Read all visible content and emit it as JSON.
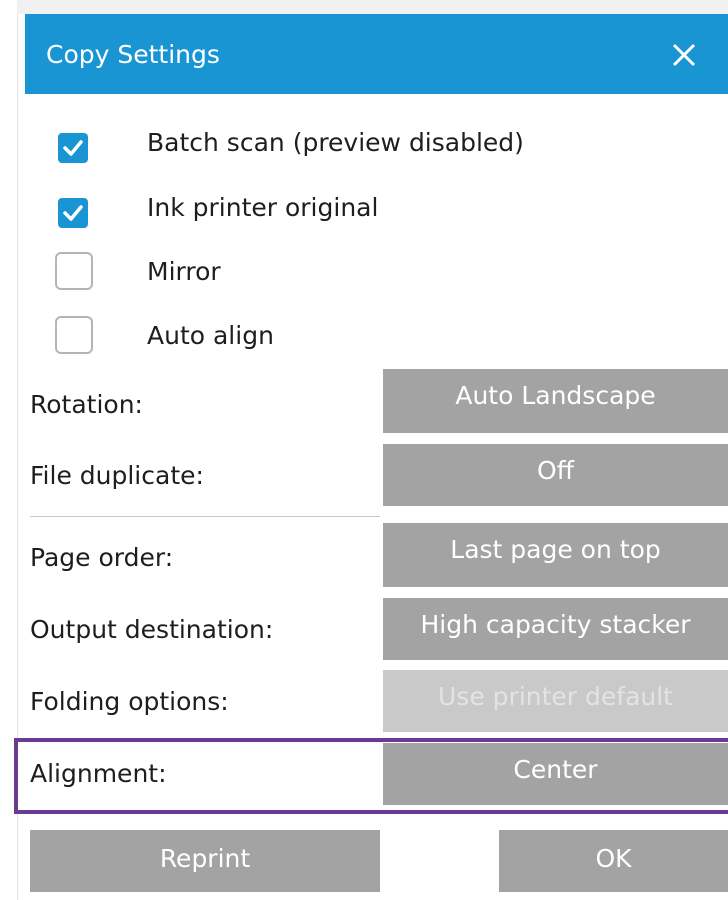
{
  "dialog": {
    "title": "Copy Settings",
    "close_icon": "close-icon",
    "accent_color": "#1a95d3"
  },
  "checkboxes": [
    {
      "label": "Batch scan (preview disabled)",
      "checked": true
    },
    {
      "label": "Ink printer original",
      "checked": true
    },
    {
      "label": "Mirror",
      "checked": false
    },
    {
      "label": "Auto align",
      "checked": false
    }
  ],
  "settings": {
    "rotation": {
      "label": "Rotation:",
      "value": "Auto Landscape"
    },
    "file_duplicate": {
      "label": "File duplicate:",
      "value": "Off"
    },
    "page_order": {
      "label": "Page order:",
      "value": "Last page on top"
    },
    "output_destination": {
      "label": "Output destination:",
      "value": "High capacity stacker"
    },
    "folding_options": {
      "label": "Folding options:",
      "value": "Use printer default",
      "enabled": false
    },
    "alignment": {
      "label": "Alignment:",
      "value": "Center",
      "highlight_color": "#6b3a92"
    }
  },
  "footer": {
    "reprint_label": "Reprint",
    "ok_label": "OK"
  }
}
